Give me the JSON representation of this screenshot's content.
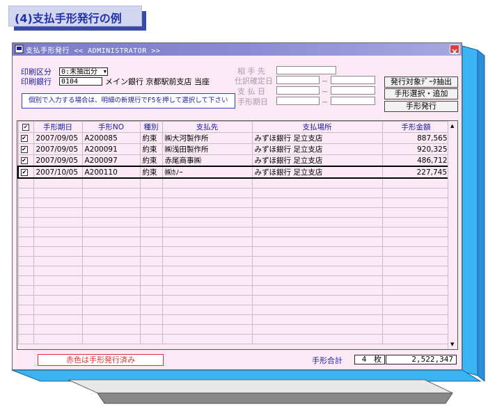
{
  "heading": "(4)支払手形発行の例",
  "window": {
    "title": "支払手形発行 << ADMINISTRATOR >>",
    "icon": "app-icon",
    "close": "close-icon"
  },
  "form": {
    "print_category_label": "印刷区分",
    "print_category_value": "0:未抽出分",
    "print_bank_label": "印刷銀行",
    "print_bank_code": "0104",
    "print_bank_name": "メイン銀行 京都駅前支店 当座",
    "counterparty_label": "相 手 先",
    "journal_date_label": "仕訳確定日",
    "payment_date_label": "支 払 日",
    "due_date_label": "手形期日",
    "tilde": "~",
    "note": "個別で入力する場合は、明細の新規行でF5を押して選択して下さい"
  },
  "buttons": {
    "extract": "発行対象ﾃﾞｰﾀ抽出",
    "select_add": "手形選択・追加",
    "issue": "手形発行"
  },
  "table": {
    "headers": [
      "",
      "手形期日",
      "手形NO",
      "種別",
      "支払先",
      "支払場所",
      "手形金額"
    ],
    "rows": [
      {
        "date": "2007/09/05",
        "no": "A200085",
        "type": "約束",
        "payee": "㈱大河製作所",
        "place": "みずほ銀行 足立支店",
        "amount": "887,565"
      },
      {
        "date": "2007/09/05",
        "no": "A200091",
        "type": "約束",
        "payee": "㈱浅田製作所",
        "place": "みずほ銀行 足立支店",
        "amount": "920,325"
      },
      {
        "date": "2007/09/05",
        "no": "A200097",
        "type": "約束",
        "payee": "赤尾商事㈱",
        "place": "みずほ銀行 足立支店",
        "amount": "486,712"
      },
      {
        "date": "2007/10/05",
        "no": "A200110",
        "type": "約束",
        "payee": "㈱ｶﾉｰ",
        "place": "みずほ銀行 足立支店",
        "amount": "227,745"
      }
    ],
    "check_mark": "✔"
  },
  "footer": {
    "legend": "赤色は手形発行済み",
    "total_label": "手形合計",
    "count": "4",
    "count_unit": "枚",
    "total_amount": "2,522,347"
  },
  "colors": {
    "heading_text": "#2233aa",
    "label_blue": "#1a1aa0",
    "disabled_label": "#a89aa8",
    "window_bg": "#fbeaf5",
    "legend_red": "#e03030",
    "accent_blue": "#3ab4f2"
  }
}
